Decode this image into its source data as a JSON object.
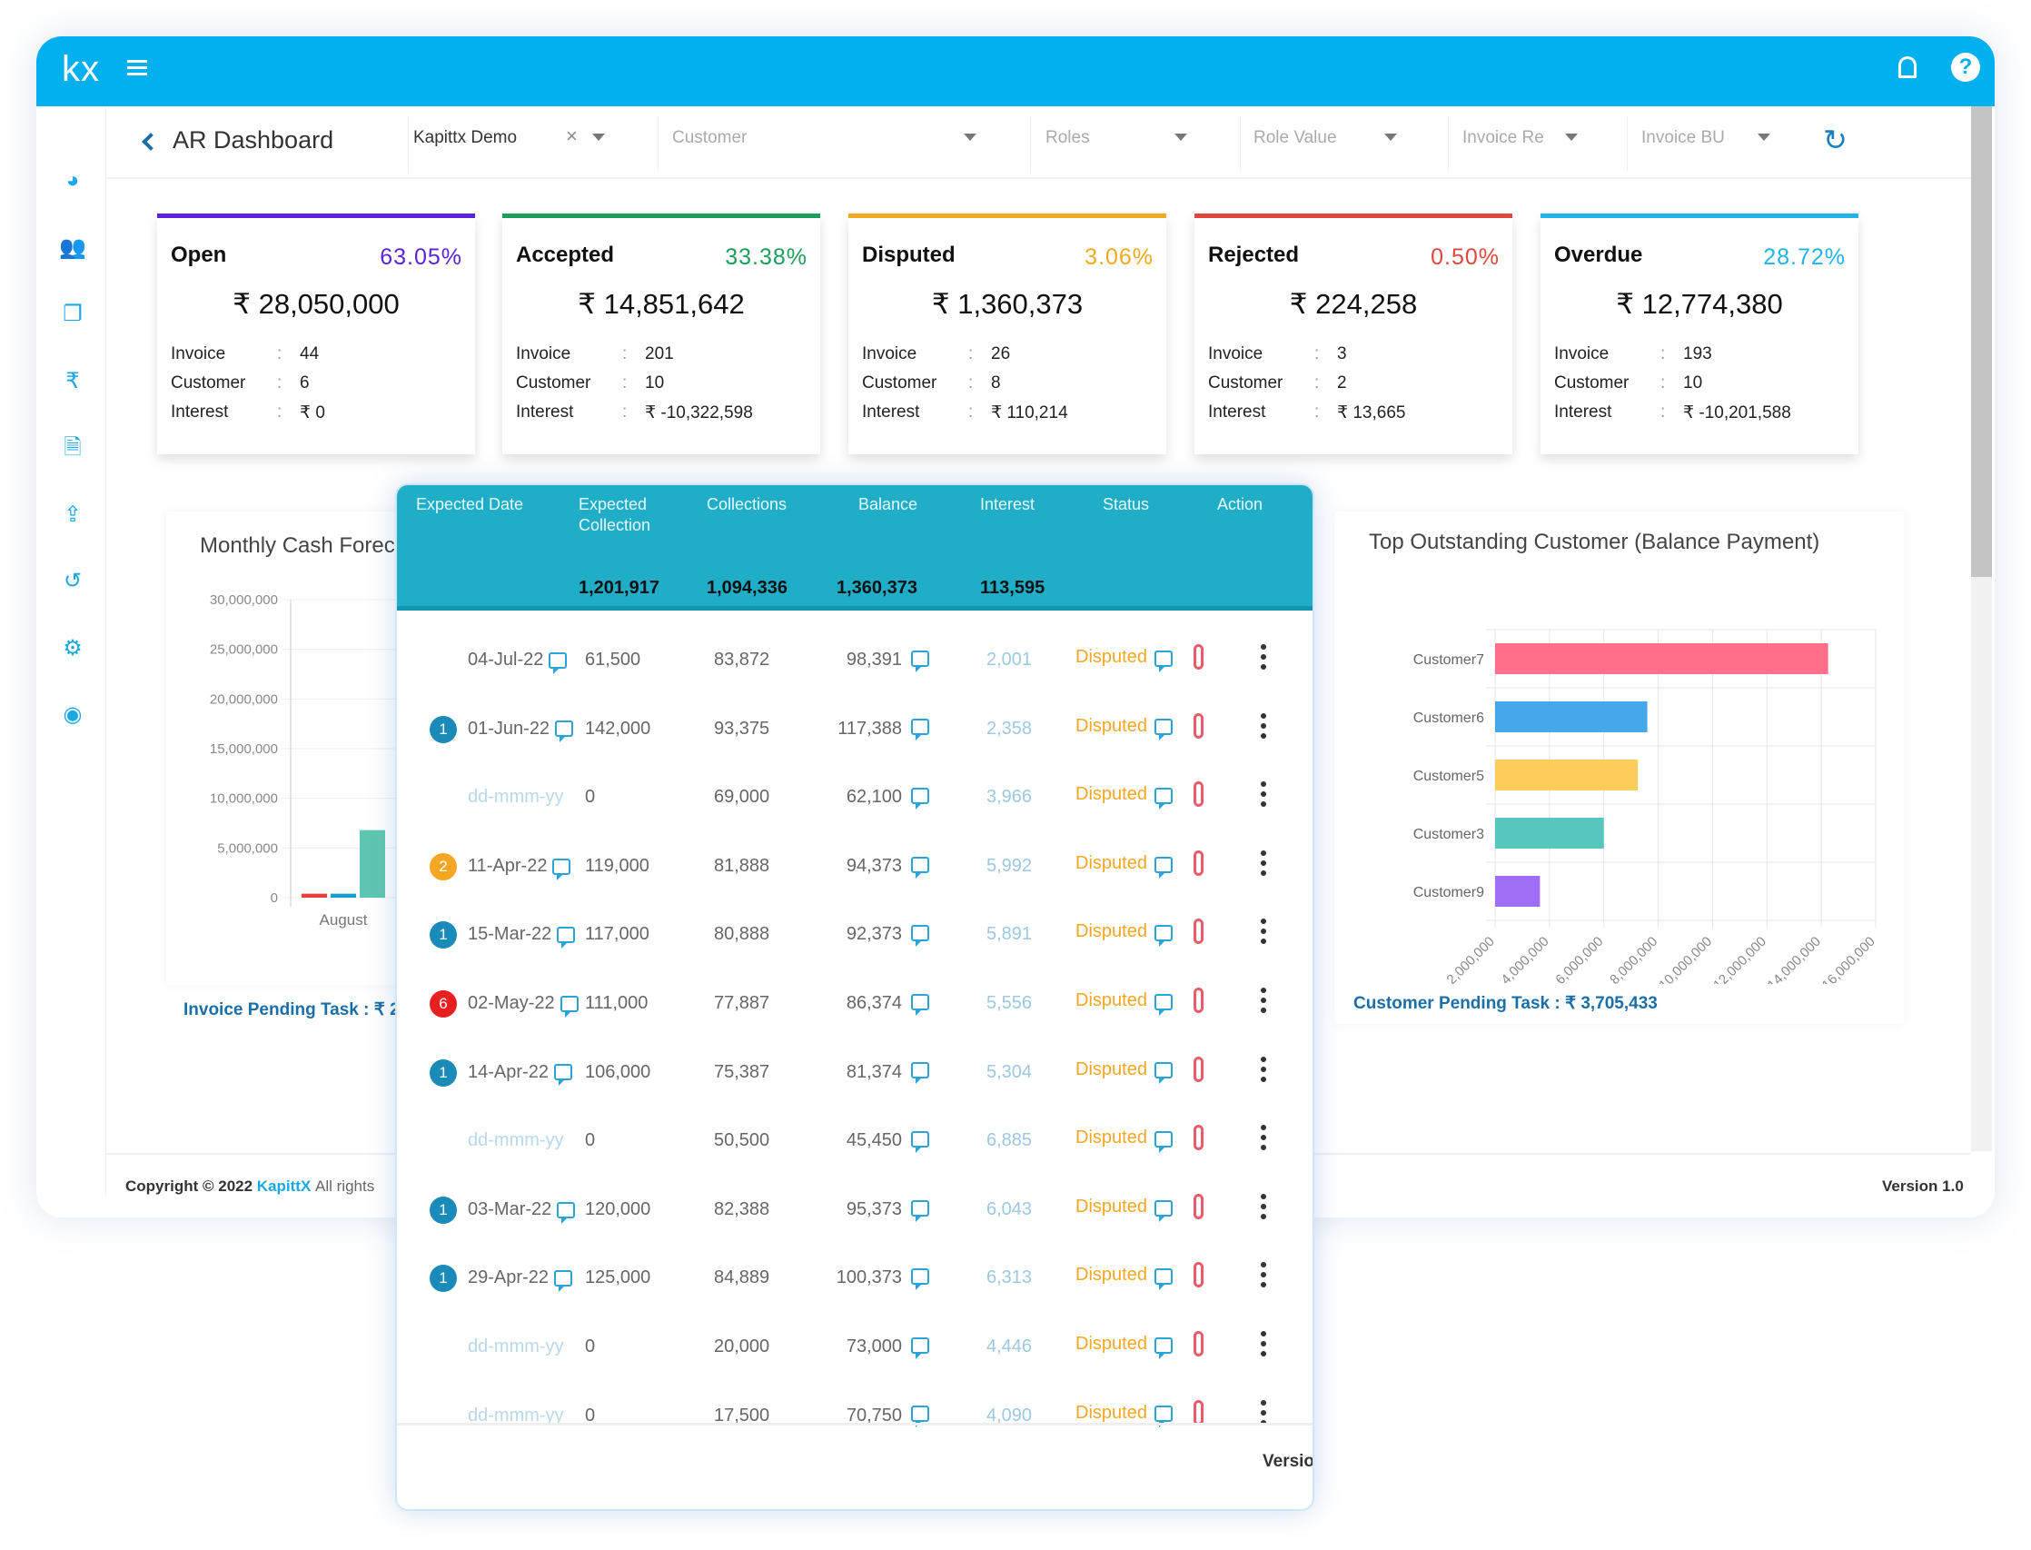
{
  "header": {
    "logo": "kx",
    "icons": [
      "menu-icon",
      "bell-icon",
      "help-icon"
    ]
  },
  "sidebar": {
    "icons": [
      "dashboard-icon",
      "users-icon",
      "documents-icon",
      "rupee-icon",
      "invoice-icon",
      "upload-icon",
      "history-icon",
      "settings-icon",
      "profile-icon"
    ]
  },
  "toolbar": {
    "title": "AR Dashboard",
    "company": "Kapittx Demo",
    "customer": "Customer",
    "roles": "Roles",
    "role_value": "Role Value",
    "invoice_re": "Invoice Re",
    "invoice_bu": "Invoice BU"
  },
  "colors": {
    "accent": "#03b0ee",
    "table_header": "#1fadc8",
    "disputed": "#f5a623"
  },
  "cards": [
    {
      "title": "Open",
      "percent": "63.05%",
      "amount": "₹ 28,050,000",
      "invoice": "44",
      "customer": "6",
      "interest": "₹ 0",
      "color": "#5b22dc"
    },
    {
      "title": "Accepted",
      "percent": "33.38%",
      "amount": "₹ 14,851,642",
      "invoice": "201",
      "customer": "10",
      "interest": "₹ -10,322,598",
      "color": "#1a9e5c"
    },
    {
      "title": "Disputed",
      "percent": "3.06%",
      "amount": "₹ 1,360,373",
      "invoice": "26",
      "customer": "8",
      "interest": "₹ 110,214",
      "color": "#f2a91d"
    },
    {
      "title": "Rejected",
      "percent": "0.50%",
      "amount": "₹ 224,258",
      "invoice": "3",
      "customer": "2",
      "interest": "₹ 13,665",
      "color": "#e0473c"
    },
    {
      "title": "Overdue",
      "percent": "28.72%",
      "amount": "₹ 12,774,380",
      "invoice": "193",
      "customer": "10",
      "interest": "₹ -10,201,588",
      "color": "#1fb5e8"
    }
  ],
  "card_labels": {
    "invoice": "Invoice",
    "customer": "Customer",
    "interest": "Interest",
    "sep": ":"
  },
  "footer": {
    "copyright": "Copyright © 2022",
    "brand": "KapittX",
    "rights": "All rights",
    "version": "Version 1.0",
    "popup_version": "Versio"
  },
  "chart_data": [
    {
      "type": "bar",
      "title": "Monthly Cash Forec",
      "categories": [
        "August"
      ],
      "ylim": [
        0,
        30000000
      ],
      "yticks": [
        "30,000,000",
        "25,000,000",
        "20,000,000",
        "15,000,000",
        "10,000,000",
        "5,000,000",
        "0"
      ],
      "series": [
        {
          "values": [
            400000
          ],
          "color": "#e8403c"
        },
        {
          "values": [
            400000
          ],
          "color": "#1a9ec9"
        },
        {
          "values": [
            6800000
          ],
          "color": "#5ec6b0"
        }
      ],
      "footer": "Invoice Pending Task : ₹ 2"
    },
    {
      "type": "bar",
      "orientation": "horizontal",
      "title": "Top Outstanding Customer (Balance Payment)",
      "categories": [
        "Customer7",
        "Customer6",
        "Customer5",
        "Customer3",
        "Customer9"
      ],
      "values": [
        14250000,
        7600000,
        7250000,
        6000000,
        3650000
      ],
      "colors": [
        "#ff6f8a",
        "#46a7e8",
        "#ffcd5c",
        "#56c6be",
        "#a06ef5"
      ],
      "xlim": [
        2000000,
        16000000
      ],
      "xticks": [
        "2,000,000",
        "4,000,000",
        "6,000,000",
        "8,000,000",
        "10,000,000",
        "12,000,000",
        "14,000,000",
        "16,000,000"
      ],
      "grid": true,
      "footer": "Customer Pending Task : ₹ 3,705,433"
    }
  ],
  "table": {
    "headers": [
      "Expected Date",
      "Expected Collection",
      "Collections",
      "Balance",
      "Interest",
      "Status",
      "Action"
    ],
    "totals": {
      "expected": "1,201,917",
      "collections": "1,094,336",
      "balance": "1,360,373",
      "interest": "113,595"
    },
    "rows": [
      {
        "badge": "",
        "date": "04-Jul-22",
        "expected": "61,500",
        "collections": "83,872",
        "balance": "98,391",
        "interest": "2,001",
        "status": "Disputed"
      },
      {
        "badge": "1",
        "badge_color": "#1a8ab8",
        "date": "01-Jun-22",
        "expected": "142,000",
        "collections": "93,375",
        "balance": "117,388",
        "interest": "2,358",
        "status": "Disputed"
      },
      {
        "badge": "",
        "date": "dd-mmm-yy",
        "placeholder": true,
        "expected": "0",
        "collections": "69,000",
        "balance": "62,100",
        "interest": "3,966",
        "status": "Disputed"
      },
      {
        "badge": "2",
        "badge_color": "#f5a623",
        "date": "11-Apr-22",
        "expected": "119,000",
        "collections": "81,888",
        "balance": "94,373",
        "interest": "5,992",
        "status": "Disputed"
      },
      {
        "badge": "1",
        "badge_color": "#1a8ab8",
        "date": "15-Mar-22",
        "expected": "117,000",
        "collections": "80,888",
        "balance": "92,373",
        "interest": "5,891",
        "status": "Disputed"
      },
      {
        "badge": "6",
        "badge_color": "#e8201f",
        "date": "02-May-22",
        "expected": "111,000",
        "collections": "77,887",
        "balance": "86,374",
        "interest": "5,556",
        "status": "Disputed"
      },
      {
        "badge": "1",
        "badge_color": "#1a8ab8",
        "date": "14-Apr-22",
        "expected": "106,000",
        "collections": "75,387",
        "balance": "81,374",
        "interest": "5,304",
        "status": "Disputed"
      },
      {
        "badge": "",
        "date": "dd-mmm-yy",
        "placeholder": true,
        "expected": "0",
        "collections": "50,500",
        "balance": "45,450",
        "interest": "6,885",
        "status": "Disputed"
      },
      {
        "badge": "1",
        "badge_color": "#1a8ab8",
        "date": "03-Mar-22",
        "expected": "120,000",
        "collections": "82,388",
        "balance": "95,373",
        "interest": "6,043",
        "status": "Disputed"
      },
      {
        "badge": "1",
        "badge_color": "#1a8ab8",
        "date": "29-Apr-22",
        "expected": "125,000",
        "collections": "84,889",
        "balance": "100,373",
        "interest": "6,313",
        "status": "Disputed"
      },
      {
        "badge": "",
        "date": "dd-mmm-yy",
        "placeholder": true,
        "expected": "0",
        "collections": "20,000",
        "balance": "73,000",
        "interest": "4,446",
        "status": "Disputed"
      },
      {
        "badge": "",
        "date": "dd-mmm-yy",
        "placeholder": true,
        "expected": "0",
        "collections": "17,500",
        "balance": "70,750",
        "interest": "4,090",
        "status": "Disputed"
      }
    ]
  }
}
